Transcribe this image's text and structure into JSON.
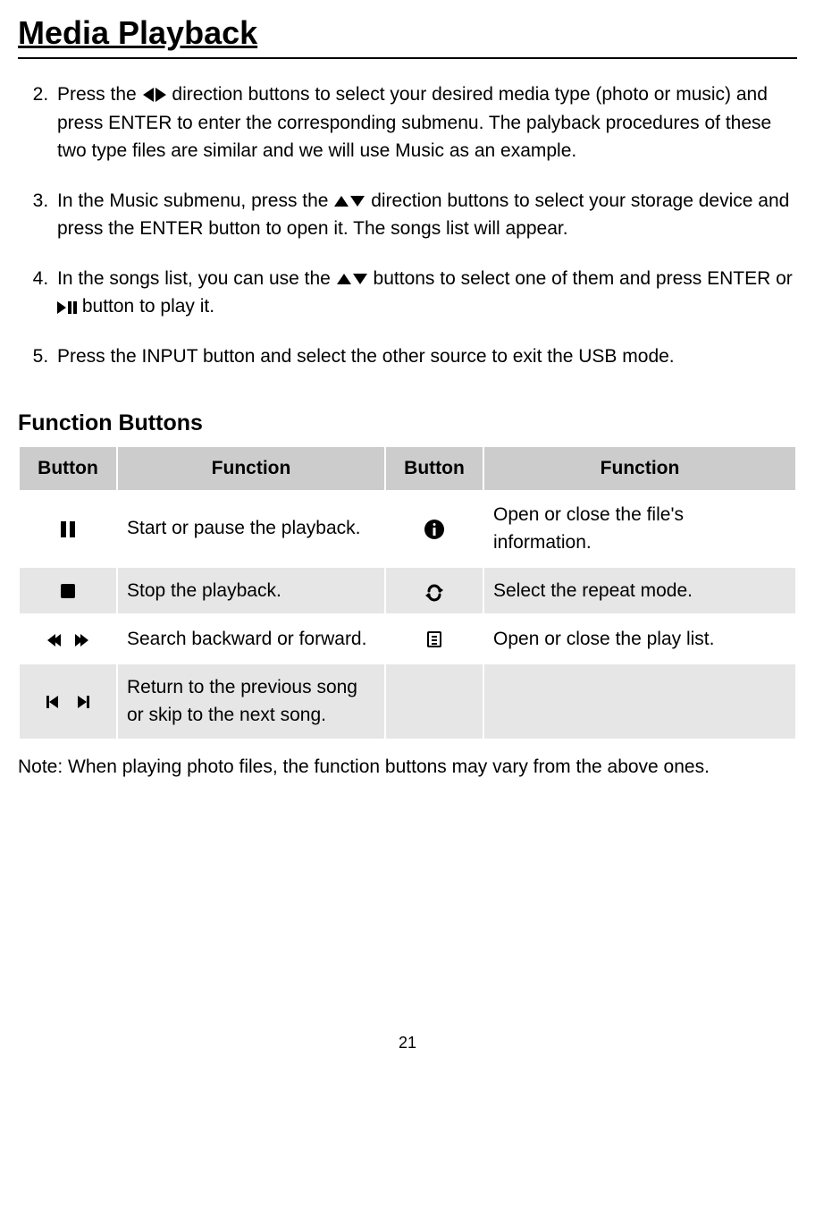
{
  "title": "Media Playback",
  "steps": {
    "s2_a": "Press the",
    "s2_b": " direction buttons to select your desired media type (photo or music) and press ENTER to enter the corresponding submenu. The palyback procedures of these two type files are similar and we will use Music as an example.",
    "s3_a": "In the Music submenu, press the",
    "s3_b": "direction buttons to select your storage device and press the ENTER button to open it. The songs list will appear.",
    "s4_a": "In the songs list, you can use the ",
    "s4_b": "buttons to select one of them and press ENTER or ",
    "s4_c": " button to play it.",
    "s5": "Press the INPUT button and select the other source to exit the USB mode."
  },
  "subheading": "Function Buttons",
  "table": {
    "h_button": "Button",
    "h_function": "Function",
    "r1f1": "Start or pause the playback.",
    "r1f2": "Open or close the file's information.",
    "r2f1": "Stop the playback.",
    "r2f2": "Select the repeat mode.",
    "r3f1": "Search backward or forward.",
    "r3f2": "Open or close the play list.",
    "r4f1": "Return to the previous song or skip to the next song."
  },
  "note": "Note: When playing photo files, the function buttons may vary from the above ones.",
  "page_number": "21"
}
